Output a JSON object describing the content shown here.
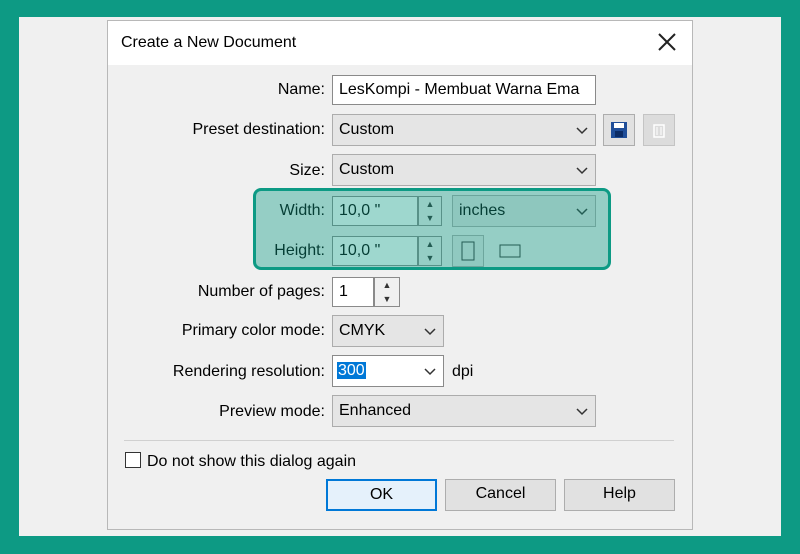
{
  "dialog": {
    "title": "Create a New Document",
    "close_icon": "close-icon"
  },
  "fields": {
    "name": {
      "label": "Name:",
      "value": "LesKompi - Membuat Warna Ema"
    },
    "preset": {
      "label": "Preset destination:",
      "value": "Custom",
      "save_icon": "save-icon",
      "delete_icon": "delete-icon"
    },
    "size": {
      "label": "Size:",
      "value": "Custom"
    },
    "width": {
      "label": "Width:",
      "value": "10,0 \"",
      "unit": "inches"
    },
    "height": {
      "label": "Height:",
      "value": "10,0 \"",
      "portrait_icon": "portrait-icon",
      "landscape_icon": "landscape-icon"
    },
    "pages": {
      "label": "Number of pages:",
      "value": "1"
    },
    "color_mode": {
      "label": "Primary color mode:",
      "value": "CMYK"
    },
    "resolution": {
      "label": "Rendering resolution:",
      "value": "300",
      "unit": "dpi"
    },
    "preview": {
      "label": "Preview mode:",
      "value": "Enhanced"
    }
  },
  "checkbox": {
    "label": "Do not show this dialog again",
    "checked": false
  },
  "buttons": {
    "ok": "OK",
    "cancel": "Cancel",
    "help": "Help"
  },
  "colors": {
    "frame": "#0d9a84",
    "highlight": "#0d9a84",
    "selection": "#0078d7"
  }
}
